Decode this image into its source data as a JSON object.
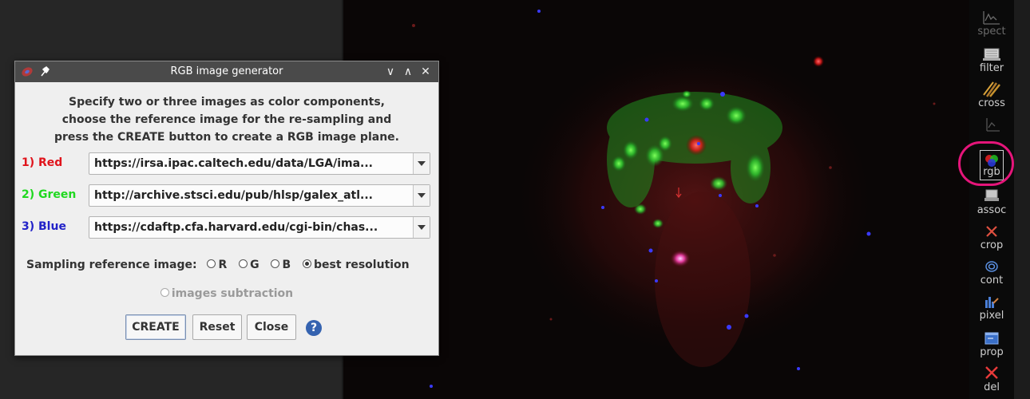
{
  "dialog": {
    "title": "RGB image generator",
    "controls": {
      "minimize": "∨",
      "maximize": "∧",
      "close": "✕"
    },
    "instructions": [
      "Specify two or three images as color components,",
      "choose the reference image for the re-sampling and",
      "press the CREATE button to create a RGB image plane."
    ],
    "components": [
      {
        "label": "1) Red",
        "color": "#e0141c",
        "value": "https://irsa.ipac.caltech.edu/data/LGA/ima..."
      },
      {
        "label": "2) Green",
        "color": "#1fd81f",
        "value": "http://archive.stsci.edu/pub/hlsp/galex_atl..."
      },
      {
        "label": "3) Blue",
        "color": "#2222c8",
        "value": "https://cdaftp.cfa.harvard.edu/cgi-bin/chas..."
      }
    ],
    "sampling": {
      "label": "Sampling reference image:",
      "options": [
        "R",
        "G",
        "B",
        "best resolution"
      ],
      "selected": "best resolution"
    },
    "subtraction_label": "images subtraction",
    "buttons": {
      "create": "CREATE",
      "reset": "Reset",
      "close": "Close"
    },
    "help_icon": "?"
  },
  "toolbar": {
    "items": [
      {
        "label": "spect",
        "icon": "spectrum-icon",
        "enabled": false
      },
      {
        "label": "filter",
        "icon": "filter-icon",
        "enabled": true
      },
      {
        "label": "cross",
        "icon": "cross-match-icon",
        "enabled": true
      },
      {
        "label": "",
        "icon": "plot-icon",
        "enabled": false
      },
      {
        "label": "rgb",
        "icon": "rgb-icon",
        "enabled": true,
        "highlighted": true
      },
      {
        "label": "assoc",
        "icon": "assoc-icon",
        "enabled": true
      },
      {
        "label": "crop",
        "icon": "crop-icon",
        "enabled": true
      },
      {
        "label": "cont",
        "icon": "contour-icon",
        "enabled": true
      },
      {
        "label": "pixel",
        "icon": "pixel-histogram-icon",
        "enabled": true
      },
      {
        "label": "prop",
        "icon": "properties-icon",
        "enabled": true
      },
      {
        "label": "del",
        "icon": "delete-icon",
        "enabled": true
      }
    ],
    "highlight_color": "#e5157a"
  }
}
